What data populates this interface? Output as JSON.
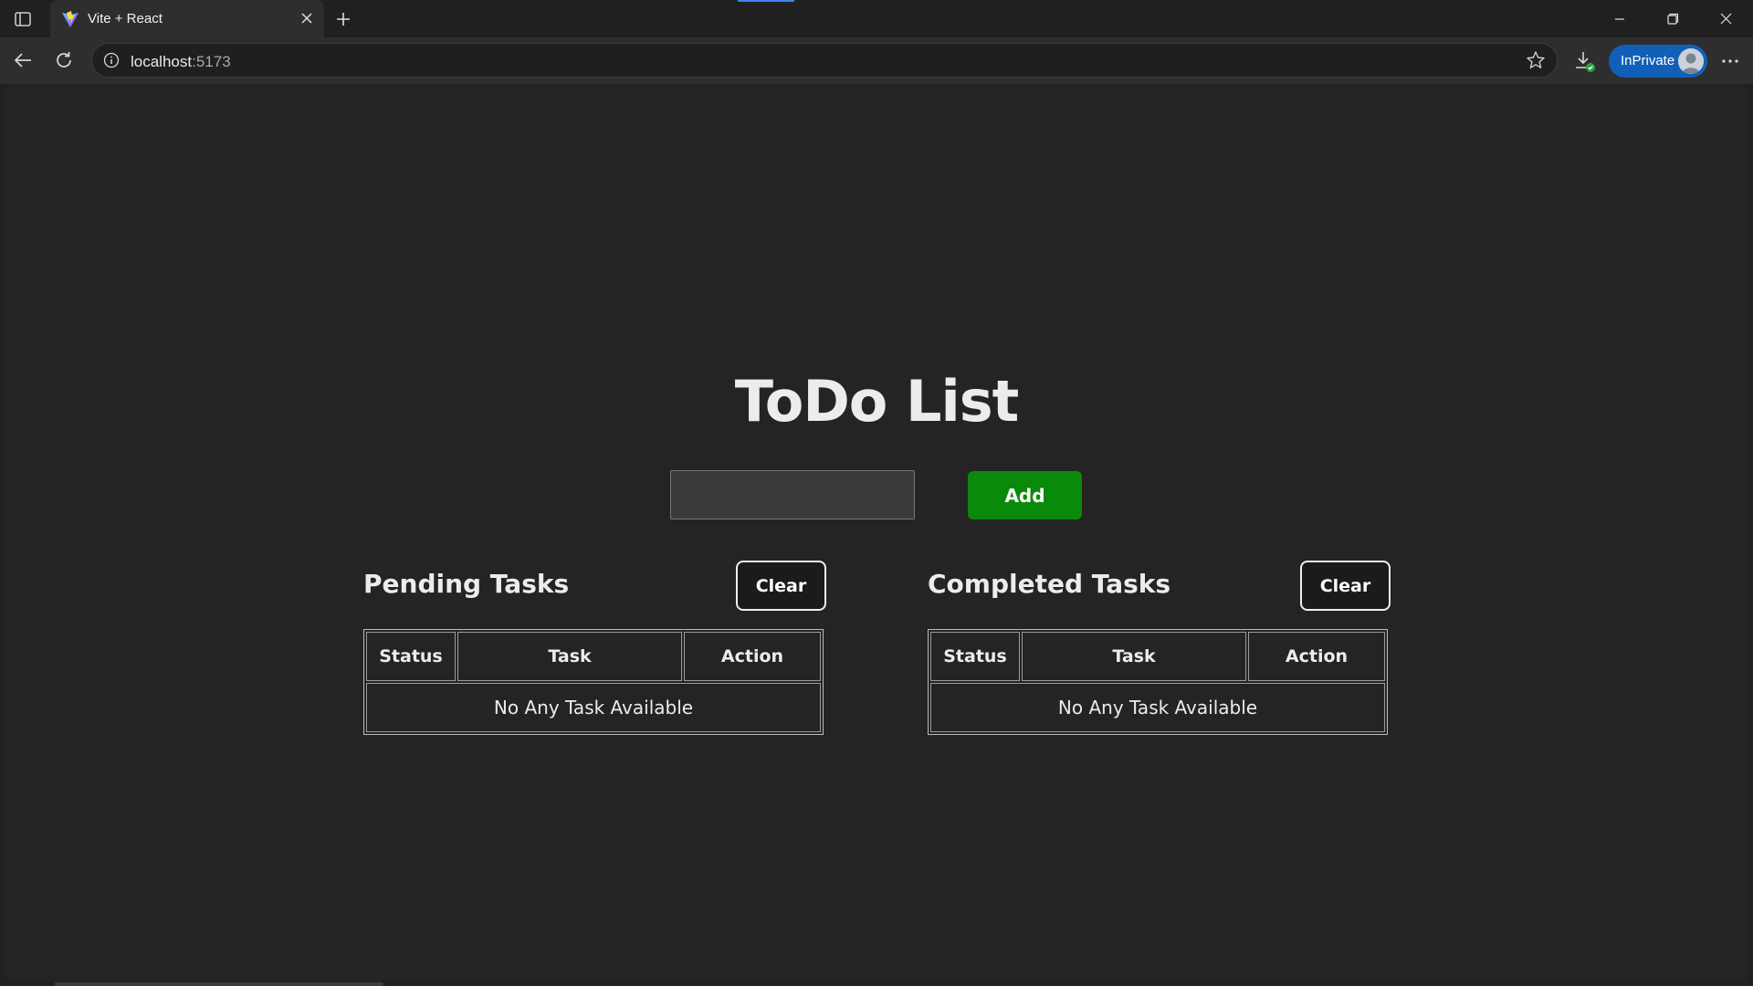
{
  "browser": {
    "tab_title": "Vite + React",
    "url_host": "localhost",
    "url_port": ":5173",
    "inprivate_label": "InPrivate",
    "accent_color": "#1160b8"
  },
  "app": {
    "heading": "ToDo List",
    "input_value": "",
    "add_label": "Add",
    "add_color": "#0a8a0a"
  },
  "pending": {
    "title": "Pending Tasks",
    "clear_label": "Clear",
    "columns": [
      "Status",
      "Task",
      "Action"
    ],
    "empty_message": "No Any Task Available"
  },
  "completed": {
    "title": "Completed Tasks",
    "clear_label": "Clear",
    "columns": [
      "Status",
      "Task",
      "Action"
    ],
    "empty_message": "No Any Task Available"
  }
}
